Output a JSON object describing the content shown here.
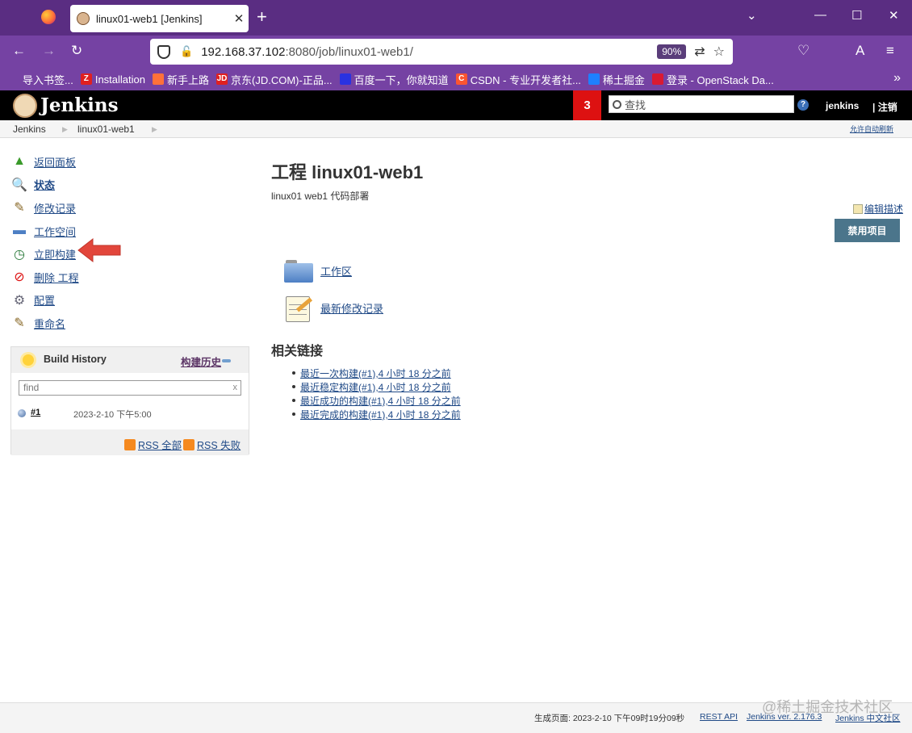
{
  "browser": {
    "tab_title": "linux01-web1 [Jenkins]",
    "url_host": "192.168.37.102",
    "url_rest": ":8080/job/linux01-web1/",
    "zoom": "90%"
  },
  "bookmarks": [
    {
      "label": "导入书签...",
      "color": "#7542a3"
    },
    {
      "label": "Installation",
      "color": "#e02020",
      "glyph": "Z"
    },
    {
      "label": "新手上路",
      "color": "#ff7139"
    },
    {
      "label": "京东(JD.COM)-正品...",
      "color": "#e02020",
      "glyph": "JD"
    },
    {
      "label": "百度一下，你就知道",
      "color": "#2932e1"
    },
    {
      "label": "CSDN - 专业开发者社...",
      "color": "#fc5531",
      "glyph": "C"
    },
    {
      "label": "稀土掘金",
      "color": "#1e80ff"
    },
    {
      "label": "登录 - OpenStack Da...",
      "color": "#da1a32"
    }
  ],
  "jenkins": {
    "title": "Jenkins",
    "notification_count": "3",
    "search_placeholder": "查找",
    "help": "?",
    "user": "jenkins",
    "logout": "| 注销"
  },
  "breadcrumb": {
    "items": [
      "Jenkins",
      "linux01-web1"
    ],
    "auto_refresh": "允许自动刷新"
  },
  "sidebar": {
    "items": [
      {
        "label": "返回面板",
        "icon": "up-arrow-icon",
        "bold": false
      },
      {
        "label": "状态",
        "icon": "search-icon",
        "bold": true
      },
      {
        "label": "修改记录",
        "icon": "notepad-icon",
        "bold": false
      },
      {
        "label": "工作空间",
        "icon": "folder-icon",
        "bold": false
      },
      {
        "label": "立即构建",
        "icon": "clock-icon",
        "bold": false
      },
      {
        "label": "删除 工程",
        "icon": "no-entry-icon",
        "bold": false
      },
      {
        "label": "配置",
        "icon": "gear-icon",
        "bold": false
      },
      {
        "label": "重命名",
        "icon": "notepad-icon",
        "bold": false
      }
    ]
  },
  "build_history": {
    "title": "Build History",
    "title_cn": "构建历史",
    "find_placeholder": "find",
    "clear": "x",
    "builds": [
      {
        "number": "#1",
        "date": "2023-2-10 下午5:00"
      }
    ],
    "rss_all": "RSS 全部",
    "rss_fail": "RSS 失败"
  },
  "main": {
    "title": "工程 linux01-web1",
    "description": "linux01 web1 代码部署",
    "edit_description": "编辑描述",
    "disable_button": "禁用项目",
    "workspace_link": "工作区",
    "changes_link": "最新修改记录",
    "related_title": "相关链接",
    "related_links": [
      "最近一次构建(#1),4 小时 18 分之前",
      "最近稳定构建(#1),4 小时 18 分之前",
      "最近成功的构建(#1),4 小时 18 分之前",
      "最近完成的构建(#1),4 小时 18 分之前"
    ]
  },
  "footer": {
    "generated": "生成页面: 2023-2-10 下午09时19分09秒",
    "rest_api": "REST API",
    "version": "Jenkins ver. 2.176.3",
    "community": "Jenkins 中文社区"
  },
  "watermark": "@稀土掘金技术社区"
}
